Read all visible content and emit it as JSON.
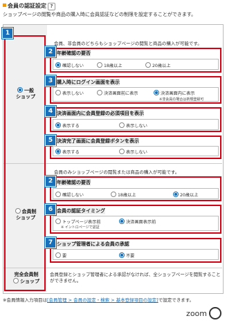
{
  "header": {
    "title": "会員の認証設定",
    "help": "?"
  },
  "description": "ショップページの閲覧や商品の購入時に会員認証などの制限を設定することができます。",
  "rows": [
    {
      "badge": "1",
      "label_line1": "一般",
      "label_line2": "ショップ",
      "intro": "会員、非会員のどちらもショップページの閲覧と商品の購入が可能です。"
    },
    {
      "badge": "",
      "label_line1": "会員制",
      "label_line2": "ショップ",
      "intro": "会員のみショップページの閲覧または商品の購入が可能です。"
    },
    {
      "badge": "",
      "label_line1": "完全会員制",
      "label_line2": "ショップ",
      "intro": "会員登録とショップ管理者による承認がなければ、全ショップページを閲覧することができません。"
    }
  ],
  "settings": {
    "s2a": {
      "badge": "2",
      "title": "年齢確認の要否",
      "options": [
        "確認しない",
        "18歳以上",
        "20歳以上"
      ]
    },
    "s3": {
      "badge": "3",
      "title": "購入時にログイン画面を表示",
      "options": [
        "表示しない",
        "決済画面前に表示",
        "決済画面内に表示"
      ],
      "note": "※非会員の場合は新規登録可"
    },
    "s4": {
      "badge": "4",
      "title": "決済画面内に会員登録の必須項目を表示",
      "options": [
        "表示する",
        "表示しない"
      ]
    },
    "s5": {
      "badge": "5",
      "title": "決済完了画面に会員登録ボタンを表示",
      "options": [
        "表示する",
        "表示しない"
      ]
    },
    "s2b": {
      "badge": "2",
      "title": "年齢確認の要否",
      "options": [
        "確認しない",
        "18歳以上",
        "20歳以上"
      ]
    },
    "s6": {
      "badge": "6",
      "title": "会員の認証タイミング",
      "options": [
        "トップページ表示前",
        "決済画面表示前"
      ],
      "note": "※ イントロページで認証"
    },
    "s7": {
      "badge": "7",
      "title": "ショップ管理者による会員の承認",
      "options": [
        "要",
        "不要"
      ]
    }
  },
  "footer": {
    "prefix": "※会員情報入力項目は",
    "link": "[会員管理 > 会員の設定・検索 > 基本登録項目の設定]",
    "suffix": "で設定できます。"
  },
  "zoom_label": "zoom"
}
